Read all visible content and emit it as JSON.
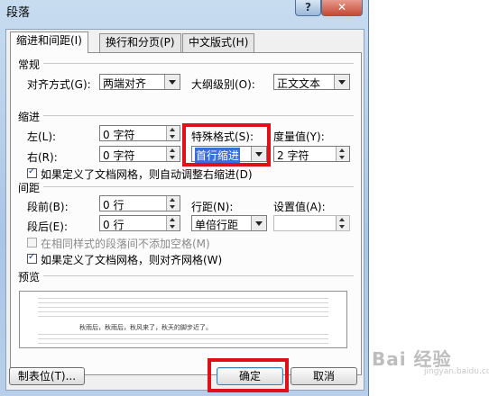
{
  "window": {
    "title": "段落",
    "help": "?",
    "close": "✕"
  },
  "tabs": [
    {
      "label": "缩进和间距(I)"
    },
    {
      "label": "换行和分页(P)"
    },
    {
      "label": "中文版式(H)"
    }
  ],
  "general": {
    "header": "常规",
    "alignment_label": "对齐方式(G):",
    "alignment_value": "两端对齐",
    "outline_label": "大纲级别(O):",
    "outline_value": "正文文本"
  },
  "indent": {
    "header": "缩进",
    "left_label": "左(L):",
    "left_value": "0 字符",
    "right_label": "右(R):",
    "right_value": "0 字符",
    "special_label": "特殊格式(S):",
    "special_value": "首行缩进",
    "measure_label": "度量值(Y):",
    "measure_value": "2 字符",
    "auto_adjust": "如果定义了文档网格，则自动调整右缩进(D)"
  },
  "spacing": {
    "header": "间距",
    "before_label": "段前(B):",
    "before_value": "0 行",
    "after_label": "段后(E):",
    "after_value": "0 行",
    "line_label": "行距(N):",
    "line_value": "单倍行距",
    "setting_label": "设置值(A):",
    "setting_value": "",
    "no_space_same_style": "在相同样式的段落间不添加空格(M)",
    "snap_grid": "如果定义了文档网格，则对齐网格(W)"
  },
  "preview": {
    "header": "预览",
    "sample_text": "秋雨后，秋雨后，秋风来了，秋天的脚步近了。"
  },
  "buttons": {
    "tabs": "制表位(T)...",
    "ok": "确定",
    "cancel": "取消"
  },
  "watermark": {
    "main": "Bai 经验",
    "sub": "jingyan.baidu.com"
  },
  "colors": {
    "highlight": "#3a6ed8",
    "annotation_red": "#e0101a"
  }
}
